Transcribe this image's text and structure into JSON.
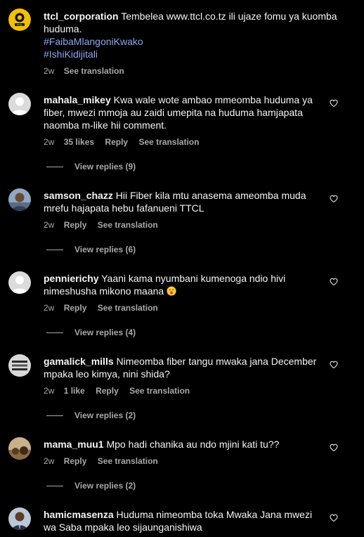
{
  "caption": {
    "username": "ttcl_corporation",
    "text": "Tembelea www.ttcl.co.tz ili ujaze fomu ya kuomba huduma.",
    "hashtags": [
      "#FaibaMlangoniKwako",
      "#IshiKidijitali"
    ],
    "time": "2w",
    "see_translation": "See translation",
    "avatar_logo_text": "TTCL",
    "avatar_color": "#f2c000"
  },
  "comments": [
    {
      "username": "mahala_mikey",
      "text": "Kwa wale wote ambao mmeomba huduma ya fiber, mwezi mmoja au zaidi umepita na huduma hamjapata naomba m-like hii comment.",
      "time": "2w",
      "likes": "35 likes",
      "reply": "Reply",
      "see_translation": "See translation",
      "view_replies": "View replies (9)"
    },
    {
      "username": "samson_chazz",
      "text": "Hii Fiber kila mtu anasema ameomba muda mrefu hajapata hebu fafanueni TTCL",
      "time": "2w",
      "likes": "",
      "reply": "Reply",
      "see_translation": "See translation",
      "view_replies": "View replies (6)"
    },
    {
      "username": "pennierichy",
      "text": "Yaani kama nyumbani kumenoga ndio hivi nimeshusha mikono maana",
      "time": "2w",
      "likes": "",
      "reply": "Reply",
      "see_translation": "See translation",
      "view_replies": "View replies (4)"
    },
    {
      "username": "gamalick_mills",
      "text": "Nimeomba fiber tangu mwaka jana December mpaka leo kimya, nini shida?",
      "time": "2w",
      "likes": "1 like",
      "reply": "Reply",
      "see_translation": "See translation",
      "view_replies": "View replies (2)"
    },
    {
      "username": "mama_muu1",
      "text": "Mpo hadi chanika au ndo mjini kati tu??",
      "time": "2w",
      "likes": "",
      "reply": "Reply",
      "see_translation": "See translation",
      "view_replies": "View replies (2)"
    },
    {
      "username": "hamicmasenza",
      "text": "Huduma nimeomba toka Mwaka Jana mwezi wa Saba mpaka leo sijaunganishiwa",
      "time": "",
      "likes": "",
      "reply": "",
      "see_translation": "",
      "view_replies": ""
    }
  ],
  "colors": {
    "background": "#000000",
    "text": "#f5f5f5",
    "secondary": "#a8a8a8",
    "hashtag": "#8ea4f0"
  }
}
